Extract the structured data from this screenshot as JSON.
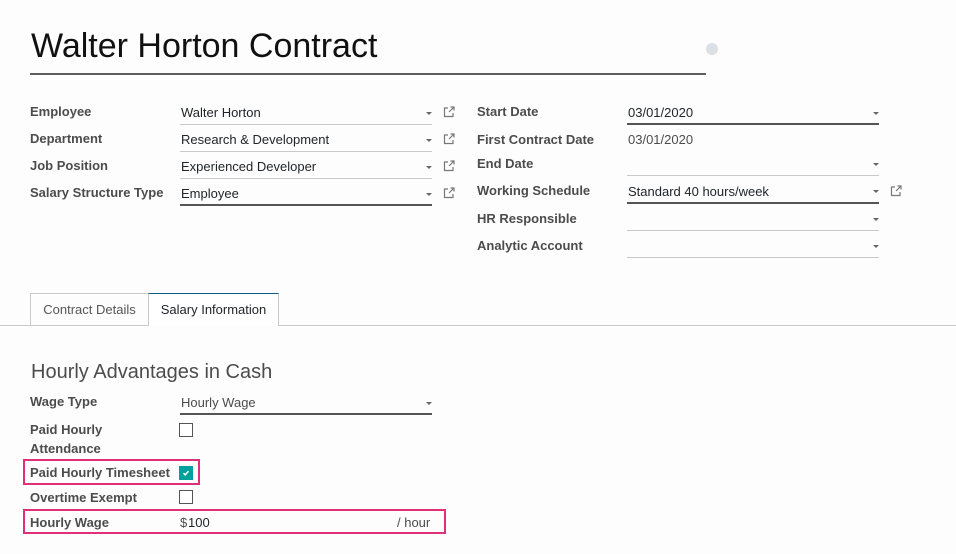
{
  "header": {
    "title": "Walter Horton Contract",
    "status_icon": "status-dot-icon"
  },
  "left_fields": [
    {
      "label": "Employee",
      "value": "Walter Horton",
      "has_external_link": true
    },
    {
      "label": "Department",
      "value": "Research & Development",
      "has_external_link": true
    },
    {
      "label": "Job Position",
      "value": "Experienced Developer",
      "has_external_link": true
    },
    {
      "label": "Salary Structure Type",
      "value": "Employee",
      "has_external_link": true
    }
  ],
  "right_fields": [
    {
      "label": "Start Date",
      "value": "03/01/2020"
    },
    {
      "label": "First Contract Date",
      "value": "03/01/2020"
    },
    {
      "label": "End Date",
      "value": ""
    },
    {
      "label": "Working Schedule",
      "value": "Standard 40 hours/week",
      "has_external_link": true
    },
    {
      "label": "HR Responsible",
      "value": ""
    },
    {
      "label": "Analytic Account",
      "value": ""
    }
  ],
  "tabs": [
    {
      "label": "Contract Details",
      "active": false
    },
    {
      "label": "Salary Information",
      "active": true
    }
  ],
  "salary": {
    "section_title": "Hourly Advantages in Cash",
    "wage_type_label": "Wage Type",
    "wage_type_value": "Hourly Wage",
    "paid_hourly_attendance_label_1": "Paid Hourly",
    "paid_hourly_attendance_label_2": "Attendance",
    "paid_hourly_attendance_checked": false,
    "paid_hourly_timesheet_label": "Paid Hourly Timesheet",
    "paid_hourly_timesheet_checked": true,
    "overtime_exempt_label": "Overtime Exempt",
    "overtime_exempt_checked": false,
    "hourly_wage_label": "Hourly Wage",
    "currency_symbol": "$",
    "hourly_wage_value": "100",
    "hourly_wage_unit": "/ hour"
  },
  "colors": {
    "checkbox_checked": "#00a09d",
    "highlight_border": "#e0307a",
    "active_tab_top": "#0d5f8a"
  }
}
